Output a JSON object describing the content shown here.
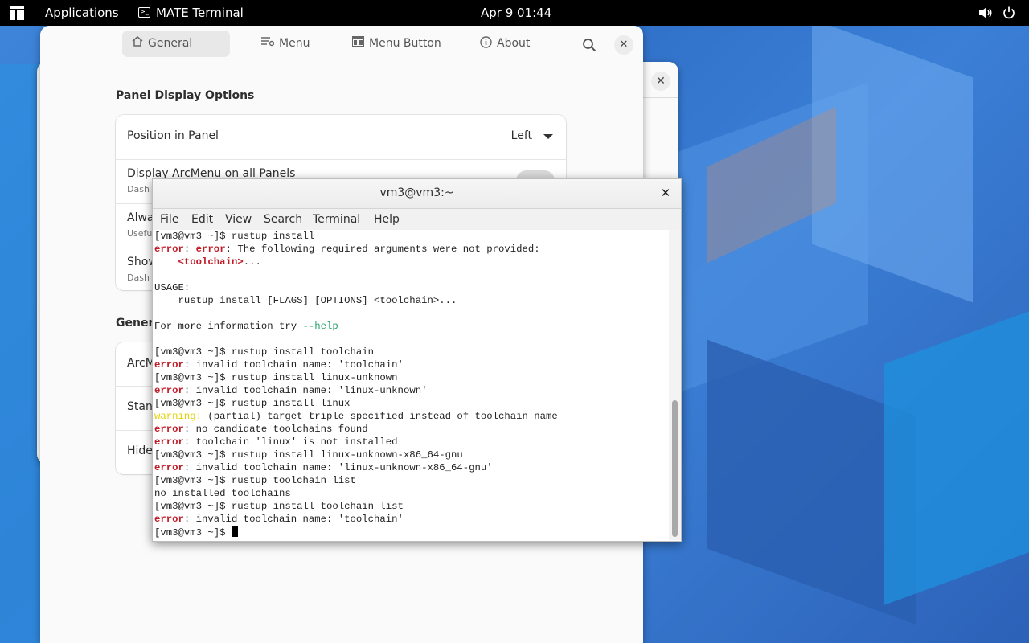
{
  "topbar": {
    "applications": "Applications",
    "app_name": "MATE Terminal",
    "clock": "Apr 9  01:44",
    "terminal_icon": ">_"
  },
  "settings": {
    "tabs": [
      {
        "label": "General",
        "icon": "home-icon"
      },
      {
        "label": "Menu",
        "icon": "menu-settings-icon"
      },
      {
        "label": "Menu Button",
        "icon": "menu-button-icon"
      },
      {
        "label": "About",
        "icon": "info-icon"
      }
    ],
    "section_title": "Panel Display Options",
    "rows": {
      "position_label": "Position in Panel",
      "position_value": "Left",
      "display_label": "Display ArcMenu on all Panels",
      "display_sub": "Dash",
      "always_label": "Alwa",
      "always_sub": "Usefu",
      "show_label": "Show",
      "show_sub": "Dash"
    },
    "section2_title": "Genera",
    "rows2": {
      "arc_label": "ArcM",
      "stand_label": "Stand",
      "hide_label": "Hide"
    },
    "close_glyph": "✕"
  },
  "terminal": {
    "title": "vm3@vm3:~",
    "menus": [
      "File",
      "Edit",
      "View",
      "Search",
      "Terminal",
      "Help"
    ],
    "close_glyph": "✕",
    "lines": [
      [
        {
          "t": "[vm3@vm3 ~]$ rustup install"
        }
      ],
      [
        {
          "t": "error",
          "c": "err"
        },
        {
          "t": ": "
        },
        {
          "t": "error",
          "c": "err"
        },
        {
          "t": ": The following required arguments were not provided:"
        }
      ],
      [
        {
          "t": "    "
        },
        {
          "t": "<toolchain>",
          "c": "ang"
        },
        {
          "t": "..."
        }
      ],
      [
        {
          "t": ""
        }
      ],
      [
        {
          "t": "USAGE:"
        }
      ],
      [
        {
          "t": "    rustup install [FLAGS] [OPTIONS] <toolchain>..."
        }
      ],
      [
        {
          "t": ""
        }
      ],
      [
        {
          "t": "For more information try "
        },
        {
          "t": "--help",
          "c": "green"
        }
      ],
      [
        {
          "t": ""
        }
      ],
      [
        {
          "t": "[vm3@vm3 ~]$ rustup install toolchain"
        }
      ],
      [
        {
          "t": "error",
          "c": "err"
        },
        {
          "t": ": invalid toolchain name: 'toolchain'"
        }
      ],
      [
        {
          "t": "[vm3@vm3 ~]$ rustup install linux-unknown"
        }
      ],
      [
        {
          "t": "error",
          "c": "err"
        },
        {
          "t": ": invalid toolchain name: 'linux-unknown'"
        }
      ],
      [
        {
          "t": "[vm3@vm3 ~]$ rustup install linux"
        }
      ],
      [
        {
          "t": "warning:",
          "c": "warn"
        },
        {
          "t": " (partial) target triple specified instead of toolchain name"
        }
      ],
      [
        {
          "t": "error",
          "c": "err"
        },
        {
          "t": ": no candidate toolchains found"
        }
      ],
      [
        {
          "t": "error",
          "c": "err"
        },
        {
          "t": ": toolchain 'linux' is not installed"
        }
      ],
      [
        {
          "t": "[vm3@vm3 ~]$ rustup install linux-unknown-x86_64-gnu"
        }
      ],
      [
        {
          "t": "error",
          "c": "err"
        },
        {
          "t": ": invalid toolchain name: 'linux-unknown-x86_64-gnu'"
        }
      ],
      [
        {
          "t": "[vm3@vm3 ~]$ rustup toolchain list"
        }
      ],
      [
        {
          "t": "no installed toolchains"
        }
      ],
      [
        {
          "t": "[vm3@vm3 ~]$ rustup install toolchain list"
        }
      ],
      [
        {
          "t": "error",
          "c": "err"
        },
        {
          "t": ": invalid toolchain name: 'toolchain'"
        }
      ],
      [
        {
          "t": "[vm3@vm3 ~]$ "
        },
        {
          "t": "",
          "c": "cursor"
        }
      ]
    ]
  },
  "colors": {
    "error": "#c01c28",
    "warning": "#e5d000",
    "help": "#26a269",
    "desktop": "#3a73c9"
  }
}
